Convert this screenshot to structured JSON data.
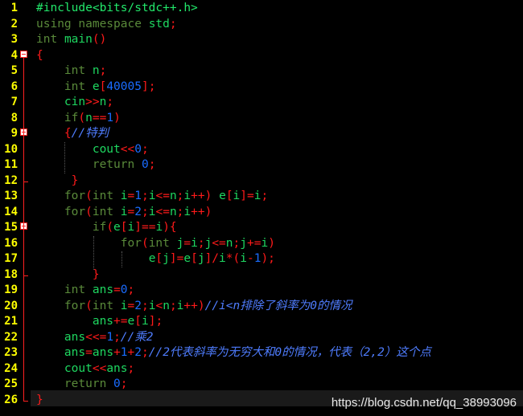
{
  "editor": {
    "line_numbers": [
      "1",
      "2",
      "3",
      "4",
      "5",
      "6",
      "7",
      "8",
      "9",
      "10",
      "11",
      "12",
      "13",
      "14",
      "15",
      "16",
      "17",
      "18",
      "19",
      "20",
      "21",
      "22",
      "23",
      "24",
      "25",
      "26"
    ],
    "lines": [
      "#include<bits/stdc++.h>",
      "using namespace std;",
      "int main()",
      "{",
      "    int n;",
      "    int e[40005];",
      "    cin>>n;",
      "    if(n==1)",
      "    {//特判",
      "        cout<<0;",
      "        return 0;",
      "     }",
      "    for(int i=1;i<=n;i++) e[i]=i;",
      "    for(int i=2;i<=n;i++)",
      "        if(e[i]==i){",
      "            for(int j=i;j<=n;j+=i)",
      "                e[j]=e[j]/i*(i-1);",
      "        }",
      "    int ans=0;",
      "    for(int i=2;i<n;i++)//i<n排除了斜率为0的情况",
      "        ans+=e[i];",
      "    ans<<=1;//乘2",
      "    ans=ans+1+2;//2代表斜率为无穷大和0的情况，代表（2,2）这个点",
      "    cout<<ans;",
      "    return 0;",
      "}"
    ]
  },
  "watermark": {
    "text": "https://blog.csdn.net/qq_38993096"
  },
  "colors": {
    "background": "#000000",
    "line_number": "#ffff00",
    "keyword": "#1ed760",
    "operator": "#ff1a1a",
    "number": "#1a6cff",
    "comment": "#4f7dff",
    "fold_marker": "#ff2020"
  }
}
